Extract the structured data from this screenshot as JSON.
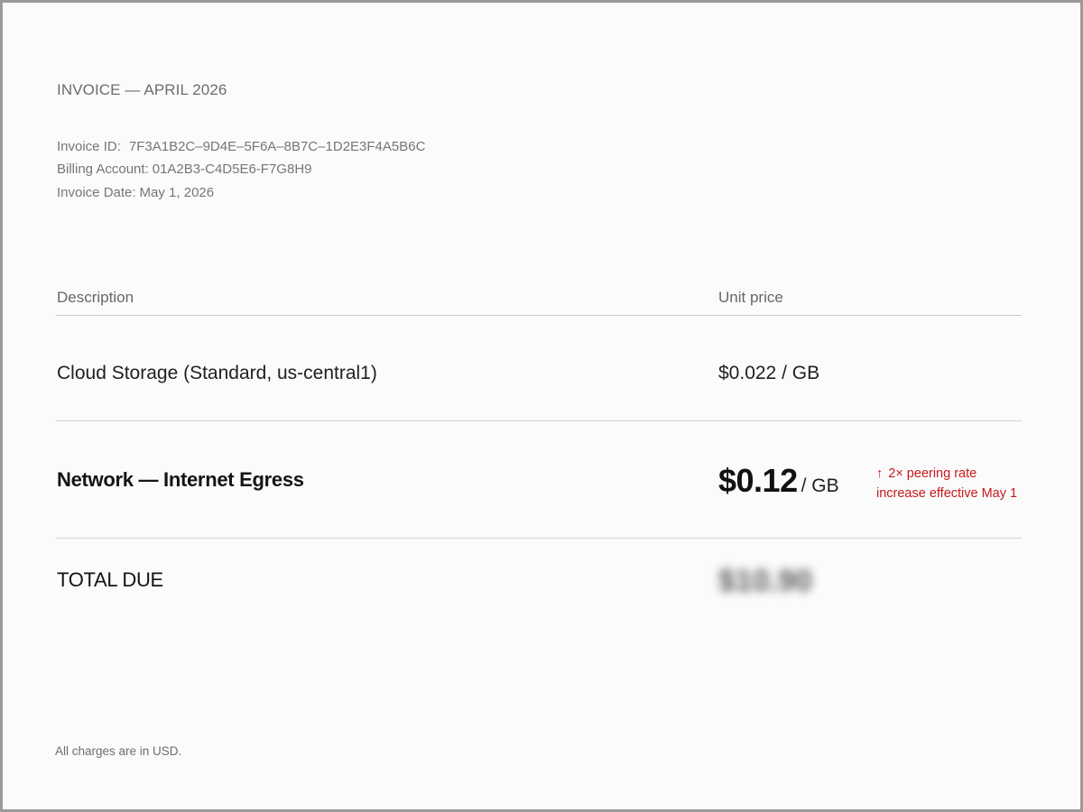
{
  "invoice": {
    "title": "INVOICE — APRIL 2026",
    "meta": {
      "invoice_id_label": "Invoice ID:",
      "invoice_id": "7F3A1B2C–9D4E–5F6A–8B7C–1D2E3F4A5B6C",
      "billing_account_label": "Billing Account:",
      "billing_account": "01A2B3-C4D5E6-F7G8H9",
      "invoice_date_label": "Invoice Date:",
      "invoice_date": "May 1, 2026"
    },
    "table": {
      "columns": [
        "Description",
        "Unit price"
      ],
      "rows": [
        {
          "description": "Cloud Storage (Standard, us-central1)",
          "unit_price": "$0.022 / GB"
        },
        {
          "description": "Network — Internet Egress",
          "amount": "$0.12",
          "unit": "/ GB",
          "note_arrow": "↑",
          "note_line1": "2× peering rate",
          "note_line2": "increase effective May 1",
          "note_color": "#c8191f"
        }
      ]
    },
    "total": {
      "label": "TOTAL DUE",
      "amount": "$10.90"
    },
    "footnote": "All charges are in USD."
  }
}
